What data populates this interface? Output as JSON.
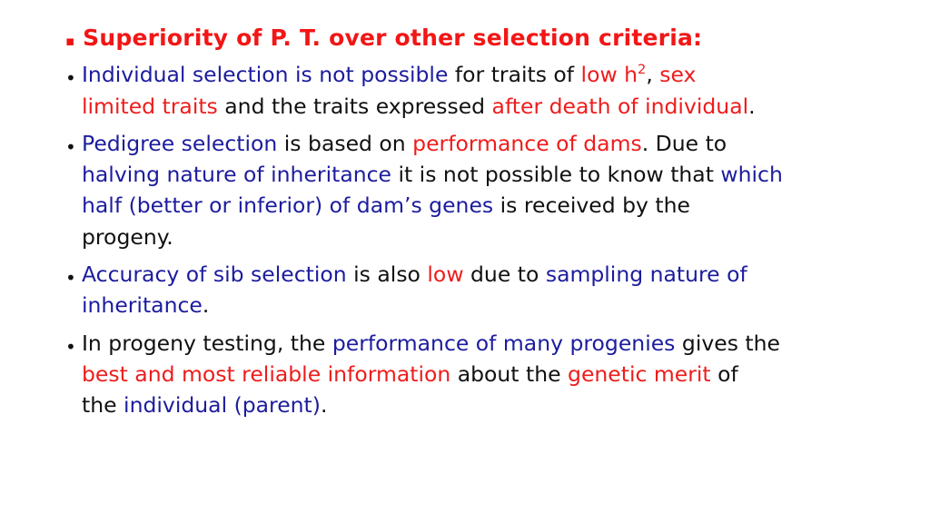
{
  "slide": {
    "background_color": "#ffffff",
    "colors": {
      "red": "#ee1c1c",
      "blue": "#1c1c9e",
      "black": "#111111",
      "heading_red": "#f21616"
    },
    "heading": {
      "bullet_glyph": "▪",
      "text": "Superiority of P. T. over other selection criteria:"
    },
    "bullet_glyph": "•",
    "bullets": [
      {
        "id": "individual-selection",
        "lines": [
          [
            {
              "t": "Individual selection is not possible ",
              "c": "blue"
            },
            {
              "t": "for traits of ",
              "c": "black"
            },
            {
              "t": "low h",
              "c": "red"
            },
            {
              "t": "2",
              "c": "red",
              "sup": true
            },
            {
              "t": ", ",
              "c": "black"
            },
            {
              "t": "sex",
              "c": "red"
            }
          ],
          [
            {
              "t": "limited traits ",
              "c": "red"
            },
            {
              "t": "and the traits expressed ",
              "c": "black"
            },
            {
              "t": "after death of individual",
              "c": "red"
            },
            {
              "t": ".",
              "c": "black"
            }
          ]
        ]
      },
      {
        "id": "pedigree-selection",
        "lines": [
          [
            {
              "t": "Pedigree selection ",
              "c": "blue"
            },
            {
              "t": "is based on ",
              "c": "black"
            },
            {
              "t": "performance of dams",
              "c": "red"
            },
            {
              "t": ". Due to",
              "c": "black"
            }
          ],
          [
            {
              "t": "halving nature of inheritance ",
              "c": "blue"
            },
            {
              "t": "it is not possible to know that ",
              "c": "black"
            },
            {
              "t": "which",
              "c": "blue"
            }
          ],
          [
            {
              "t": "half (better or inferior) of dam’s genes ",
              "c": "blue"
            },
            {
              "t": "is received by the",
              "c": "black"
            }
          ],
          [
            {
              "t": "progeny.",
              "c": "black"
            }
          ]
        ]
      },
      {
        "id": "sib-selection",
        "lines": [
          [
            {
              "t": "Accuracy of sib selection ",
              "c": "blue"
            },
            {
              "t": "is also ",
              "c": "black"
            },
            {
              "t": "low ",
              "c": "red"
            },
            {
              "t": "due to ",
              "c": "black"
            },
            {
              "t": "sampling nature of",
              "c": "blue"
            }
          ],
          [
            {
              "t": "inheritance",
              "c": "blue"
            },
            {
              "t": ".",
              "c": "black"
            }
          ]
        ]
      },
      {
        "id": "progeny-testing",
        "lines": [
          [
            {
              "t": "In progeny testing, the ",
              "c": "black"
            },
            {
              "t": "performance of many progenies ",
              "c": "blue"
            },
            {
              "t": "gives the",
              "c": "black"
            }
          ],
          [
            {
              "t": "best and most reliable information ",
              "c": "red"
            },
            {
              "t": "about the ",
              "c": "black"
            },
            {
              "t": "genetic merit ",
              "c": "red"
            },
            {
              "t": "of",
              "c": "black"
            }
          ],
          [
            {
              "t": "the ",
              "c": "black"
            },
            {
              "t": "individual (parent)",
              "c": "blue"
            },
            {
              "t": ".",
              "c": "black"
            }
          ]
        ]
      }
    ]
  }
}
